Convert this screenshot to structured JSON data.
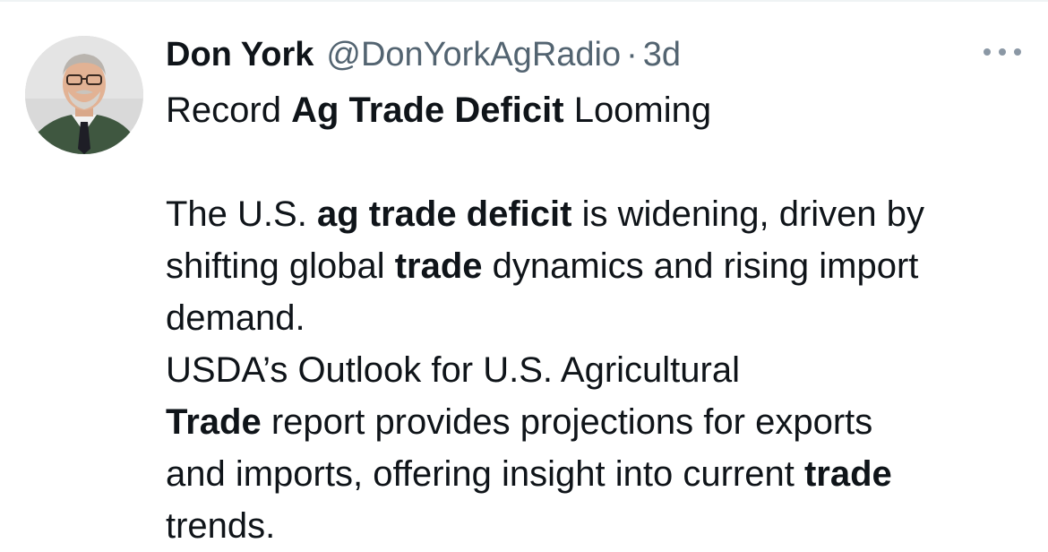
{
  "tweet": {
    "author": {
      "display_name": "Don York",
      "handle": "@DonYorkAgRadio",
      "separator": "·",
      "timestamp": "3d"
    },
    "more_icon": "more-horizontal-icon",
    "headline": {
      "part1": "Record ",
      "bold": "Ag Trade Deficit",
      "part2": " Looming"
    },
    "paragraph1": {
      "part1": "The U.S. ",
      "bold1": "ag trade deficit",
      "part2": " is widening, driven by",
      "part3": "shifting global ",
      "bold2": "trade",
      "part4": " dynamics and rising import",
      "part5": "demand."
    },
    "paragraph2": {
      "line1": "USDA’s Outlook for U.S. Agricultural",
      "bold1": "Trade",
      "part2": " report provides projections for exports",
      "part3": "and imports, offering insight into current ",
      "bold2": "trade",
      "part4": "trends."
    }
  }
}
